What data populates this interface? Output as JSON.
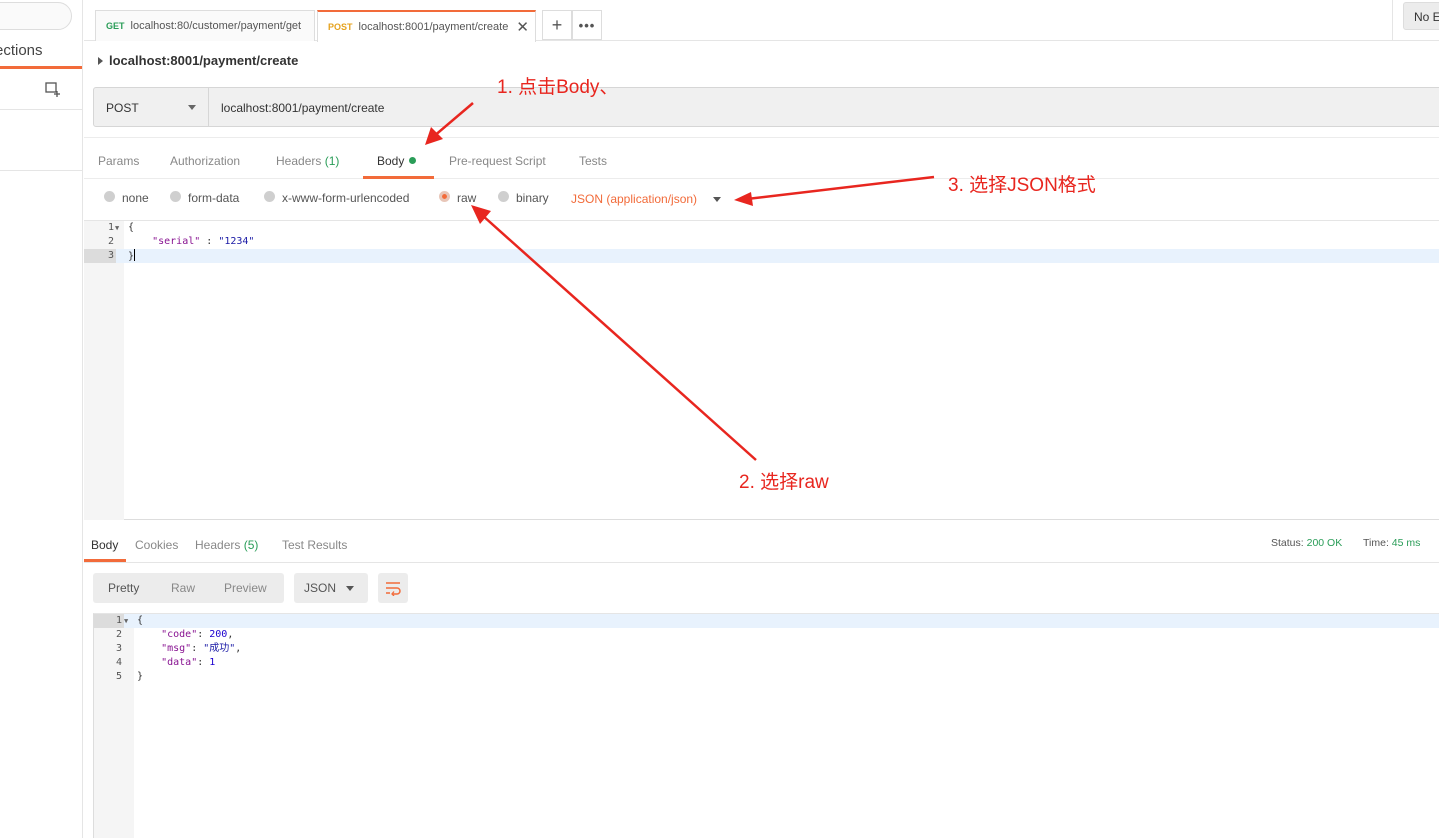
{
  "sidebar": {
    "tab_label": "ections"
  },
  "tabs": [
    {
      "method": "GET",
      "url": "localhost:80/customer/payment/get"
    },
    {
      "method": "POST",
      "url": "localhost:8001/payment/create"
    }
  ],
  "env": {
    "selected": "No E"
  },
  "request": {
    "name": "localhost:8001/payment/create",
    "method": "POST",
    "url": "localhost:8001/payment/create"
  },
  "request_tabs": {
    "params": "Params",
    "authorization": "Authorization",
    "headers": "Headers",
    "headers_count": "(1)",
    "body": "Body",
    "prerequest": "Pre-request Script",
    "tests": "Tests"
  },
  "body_types": {
    "none": "none",
    "form_data": "form-data",
    "urlencoded": "x-www-form-urlencoded",
    "raw": "raw",
    "binary": "binary",
    "selected": "raw",
    "format": "JSON (application/json)"
  },
  "request_body": {
    "line_numbers": [
      "1",
      "2",
      "3"
    ],
    "open_brace": "{",
    "key": "\"serial\"",
    "sep": " : ",
    "value": "\"1234\"",
    "close_brace": "}"
  },
  "response_tabs": {
    "body": "Body",
    "cookies": "Cookies",
    "headers": "Headers",
    "headers_count": "(5)",
    "test_results": "Test Results"
  },
  "response_status": {
    "status_label": "Status:",
    "status_value": "200 OK",
    "time_label": "Time:",
    "time_value": "45 ms"
  },
  "response_view": {
    "pretty": "Pretty",
    "raw": "Raw",
    "preview": "Preview",
    "format": "JSON"
  },
  "response_body": {
    "line_numbers": [
      "1",
      "2",
      "3",
      "4",
      "5"
    ],
    "open_brace": "{",
    "code_key": "\"code\"",
    "code_val": "200",
    "msg_key": "\"msg\"",
    "msg_val": "\"成功\"",
    "data_key": "\"data\"",
    "data_val": "1",
    "close_brace": "}"
  },
  "annotations": {
    "step1": "1. 点击Body、",
    "step2": "2. 选择raw",
    "step3": "3. 选择JSON格式"
  },
  "colors": {
    "accent": "#f26b3a",
    "success": "#2a9d58",
    "annotation": "#e8261f"
  }
}
